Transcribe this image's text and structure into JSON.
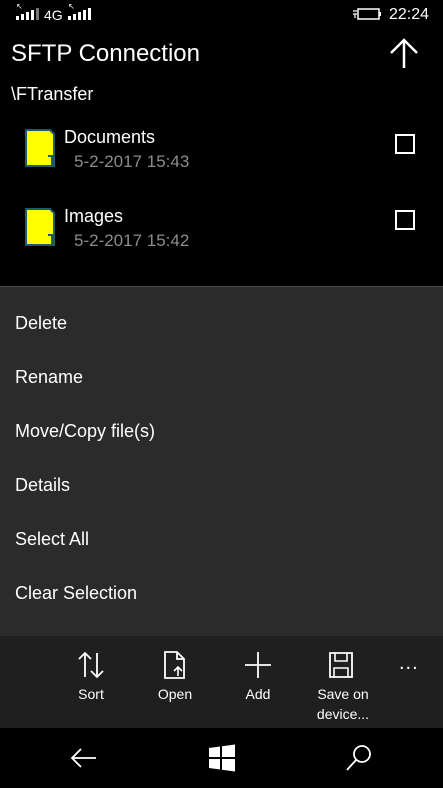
{
  "status": {
    "network": "4G",
    "time": "22:24"
  },
  "header": {
    "title": "SFTP Connection",
    "path": "\\FTransfer"
  },
  "files": [
    {
      "name": "Documents",
      "date": "5-2-2017 15:43"
    },
    {
      "name": "Images",
      "date": "5-2-2017 15:42"
    }
  ],
  "menu": {
    "items": [
      "Delete",
      "Rename",
      "Move/Copy file(s)",
      "Details",
      "Select All",
      "Clear Selection"
    ]
  },
  "appbar": {
    "sort": "Sort",
    "open": "Open",
    "add": "Add",
    "save": "Save on device...",
    "more": "..."
  },
  "colors": {
    "folder": "#ffff00",
    "menu_bg": "#2b2b2b",
    "appbar_bg": "#1f1f1f"
  }
}
